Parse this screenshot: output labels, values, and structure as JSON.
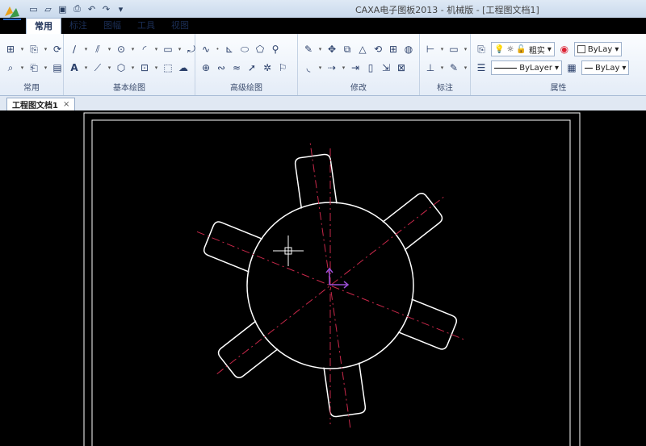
{
  "window": {
    "title": "CAXA电子图板2013 - 机械版 - [工程图文档1]"
  },
  "ribbon_tabs": [
    "常用",
    "标注",
    "图幅",
    "工具",
    "视图"
  ],
  "active_tab": "常用",
  "groups": {
    "common": "常用",
    "basic_draw": "基本绘图",
    "advanced_draw": "高级绘图",
    "modify": "修改",
    "annotate": "标注",
    "properties": "属性"
  },
  "properties": {
    "layer_name": "粗实",
    "color": "ByLay",
    "linetype": "ByLayer",
    "lineweight": "ByLay"
  },
  "document_tab": {
    "label": "工程图文档1",
    "close": "×"
  },
  "icons": {
    "app_logo": "caxa-logo-icon",
    "qat": [
      "new-icon",
      "open-icon",
      "save-icon",
      "print-icon",
      "undo-icon",
      "redo-icon",
      "customize-icon"
    ]
  },
  "colors": {
    "canvas": "#000000",
    "geometry": "#ffffff",
    "centerline": "#c8284a",
    "ucs": "#9a4fd6",
    "ribbon_bg": "#e4ecf7"
  }
}
